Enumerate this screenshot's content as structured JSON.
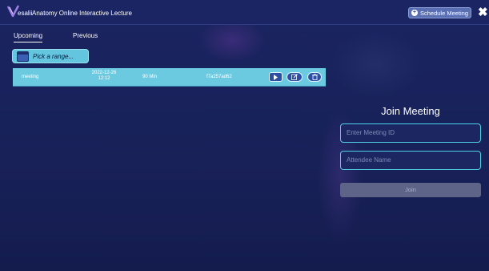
{
  "header": {
    "logo_text": "esalii",
    "title": "Anatomy Online Interactive Lecture",
    "schedule_label": "Schedule Meeting",
    "close_label": "✖"
  },
  "tabs": [
    {
      "label": "Upcoming",
      "active": true
    },
    {
      "label": "Previous",
      "active": false
    }
  ],
  "range_picker": {
    "placeholder": "Pick a range..."
  },
  "meetings": [
    {
      "name": "meeting",
      "date": "2022-12-26",
      "time": "12:12",
      "duration": "90 Min",
      "id": "f7a257ad62"
    }
  ],
  "join": {
    "title": "Join Meeting",
    "meeting_id_placeholder": "Enter Meeting ID",
    "attendee_placeholder": "Attendee Name",
    "button_label": "Join"
  },
  "colors": {
    "accent": "#64c5de",
    "background": "#162058",
    "input_border": "#4fd0e6"
  }
}
